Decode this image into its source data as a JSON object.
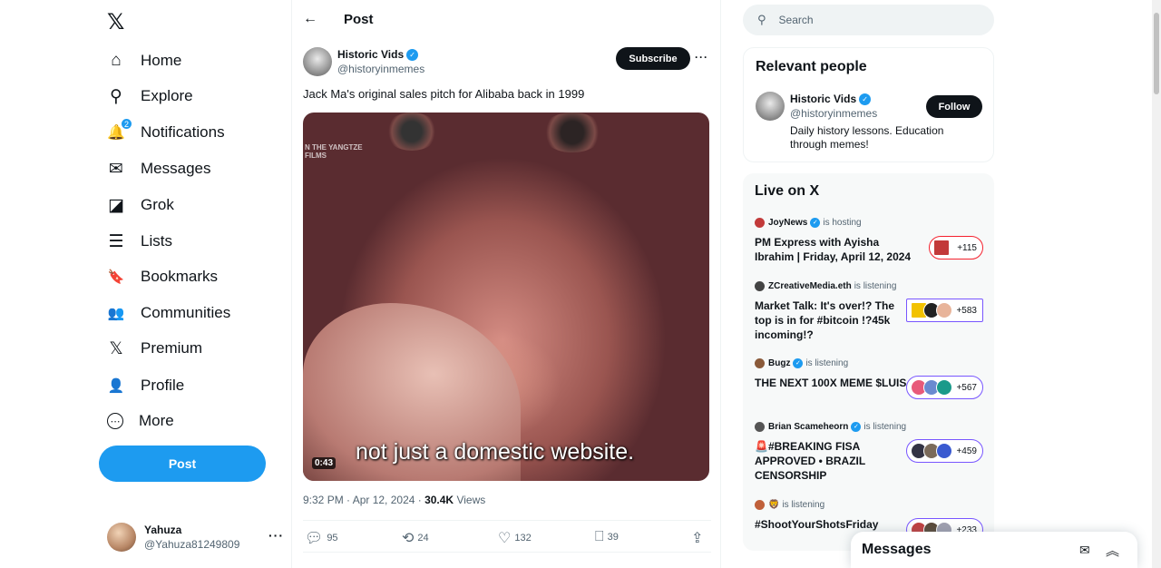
{
  "nav": {
    "logo": "𝕏",
    "items": [
      {
        "label": "Home",
        "icon": "⌂"
      },
      {
        "label": "Explore",
        "icon": "⚲"
      },
      {
        "label": "Notifications",
        "icon": "🔔"
      },
      {
        "label": "Messages",
        "icon": "✉"
      },
      {
        "label": "Grok",
        "icon": "◪"
      },
      {
        "label": "Lists",
        "icon": "☰"
      },
      {
        "label": "Bookmarks",
        "icon": "🔖"
      },
      {
        "label": "Communities",
        "icon": "👥"
      },
      {
        "label": "Premium",
        "icon": "𝕏"
      },
      {
        "label": "Profile",
        "icon": "👤"
      },
      {
        "label": "More",
        "icon": "⋯"
      }
    ],
    "notification_count": "2",
    "post_label": "Post",
    "account": {
      "name": "Yahuza",
      "handle": "@Yahuza81249809",
      "menu": "···"
    }
  },
  "main": {
    "back_icon": "←",
    "title": "Post",
    "author": {
      "name": "Historic Vids",
      "handle": "@historyinmemes",
      "verified": "✓"
    },
    "subscribe_label": "Subscribe",
    "more_icon": "···",
    "text": "Jack Ma's original sales pitch for Alibaba back in 1999",
    "video": {
      "watermark_line1": "N THE YANGTZE",
      "watermark_line2": "FILMS",
      "caption": "not just a domestic website.",
      "duration": "0:43"
    },
    "time": "9:32 PM · Apr 12, 2024 · ",
    "views_count": "30.4K",
    "views_label": " Views",
    "actions": {
      "replies": "95",
      "reposts": "24",
      "likes": "132",
      "bookmarks": "39"
    }
  },
  "right": {
    "search_placeholder": "Search",
    "relevant": {
      "heading": "Relevant people",
      "name": "Historic Vids",
      "handle": "@historyinmemes",
      "bio": "Daily history lessons. Education through memes!",
      "follow_label": "Follow"
    },
    "live": {
      "heading": "Live on X",
      "items": [
        {
          "host": "JoyNews",
          "status": "is hosting",
          "title": "PM Express with Ayisha Ibrahim | Friday, April 12, 2024",
          "count": "+115"
        },
        {
          "host": "ZCreativeMedia.eth",
          "status": "is listening",
          "title": "Market Talk: It's over!? The top is in for #bitcoin !?45k incoming!?",
          "count": "+583"
        },
        {
          "host": "Bugz",
          "status": "is listening",
          "title": "THE NEXT 100X MEME $LUIS",
          "count": "+567"
        },
        {
          "host": "Brian Scameheorn",
          "status": "is listening",
          "title": "🚨#BREAKING FISA APPROVED • BRAZIL CENSORSHIP",
          "count": "+459"
        },
        {
          "host": "🦁",
          "status": "is listening",
          "title": "#ShootYourShotsFriday",
          "count": "+233"
        }
      ]
    }
  },
  "messages_dock": {
    "title": "Messages",
    "compose_icon": "✉",
    "expand_icon": "︽"
  },
  "colors": {
    "accent": "#1d9bf0",
    "text": "#0f1419",
    "muted": "#536471",
    "space_purple": "#7856ff"
  }
}
